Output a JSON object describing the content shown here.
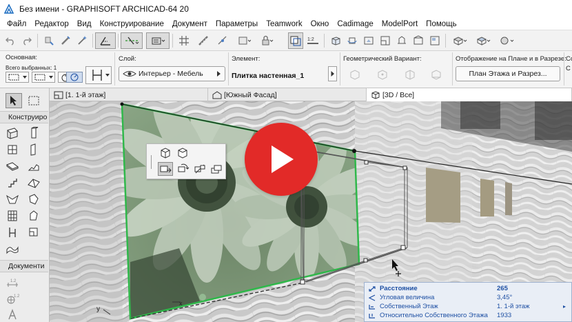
{
  "window": {
    "title": "Без имени - GRAPHISOFT ARCHICAD-64 20"
  },
  "menu": [
    "Файл",
    "Редактор",
    "Вид",
    "Конструирование",
    "Документ",
    "Параметры",
    "Teamwork",
    "Окно",
    "Cadimage",
    "ModelPort",
    "Помощь"
  ],
  "infobox": {
    "main_label": "Основная:",
    "selected_label": "Всего выбранных: 1",
    "layer_label": "Слой:",
    "layer_value": "Интерьер - Мебель",
    "element_label": "Элемент:",
    "element_value": "Плитка настенная_1",
    "geometry_label": "Геометрический Вариант:",
    "display_label": "Отображение на Плане и в Разрезе:",
    "display_value": "План Этажа и Разрез...",
    "right_cut_1": "Со",
    "right_cut_2": "С"
  },
  "toolbox": {
    "design_header": "Конструиро",
    "document_header": "Документи"
  },
  "tabs": [
    {
      "label": "[1. 1-й этаж]",
      "icon": "floor-plan-icon"
    },
    {
      "label": "[Южный Фасад]",
      "icon": "elevation-icon"
    },
    {
      "label": "[3D / Все]",
      "icon": "3d-view-icon"
    }
  ],
  "viewport": {
    "axis_y_label": "y",
    "axis_x_label": "x",
    "play_icon": "play-icon"
  },
  "tracker": {
    "rows": [
      {
        "icon": "distance-icon",
        "label": "Расстояние",
        "value": "265",
        "bold": true
      },
      {
        "icon": "angle-icon",
        "label": "Угловая величина",
        "value": "3,45°",
        "bold": false
      },
      {
        "icon": "home-story-icon",
        "label": "Собственный Этаж",
        "value": "1. 1-й этаж",
        "bold": false
      },
      {
        "icon": "relative-story-icon",
        "label": "Относительно Собственного Этажа",
        "value": "1933",
        "bold": false
      }
    ],
    "dropdown_arrow": "▸"
  },
  "colors": {
    "accent_blue": "#1d4fa3",
    "selection_green": "#2fb84a",
    "play_red": "#e22a28",
    "pressed_button": "#dcdcdc"
  }
}
